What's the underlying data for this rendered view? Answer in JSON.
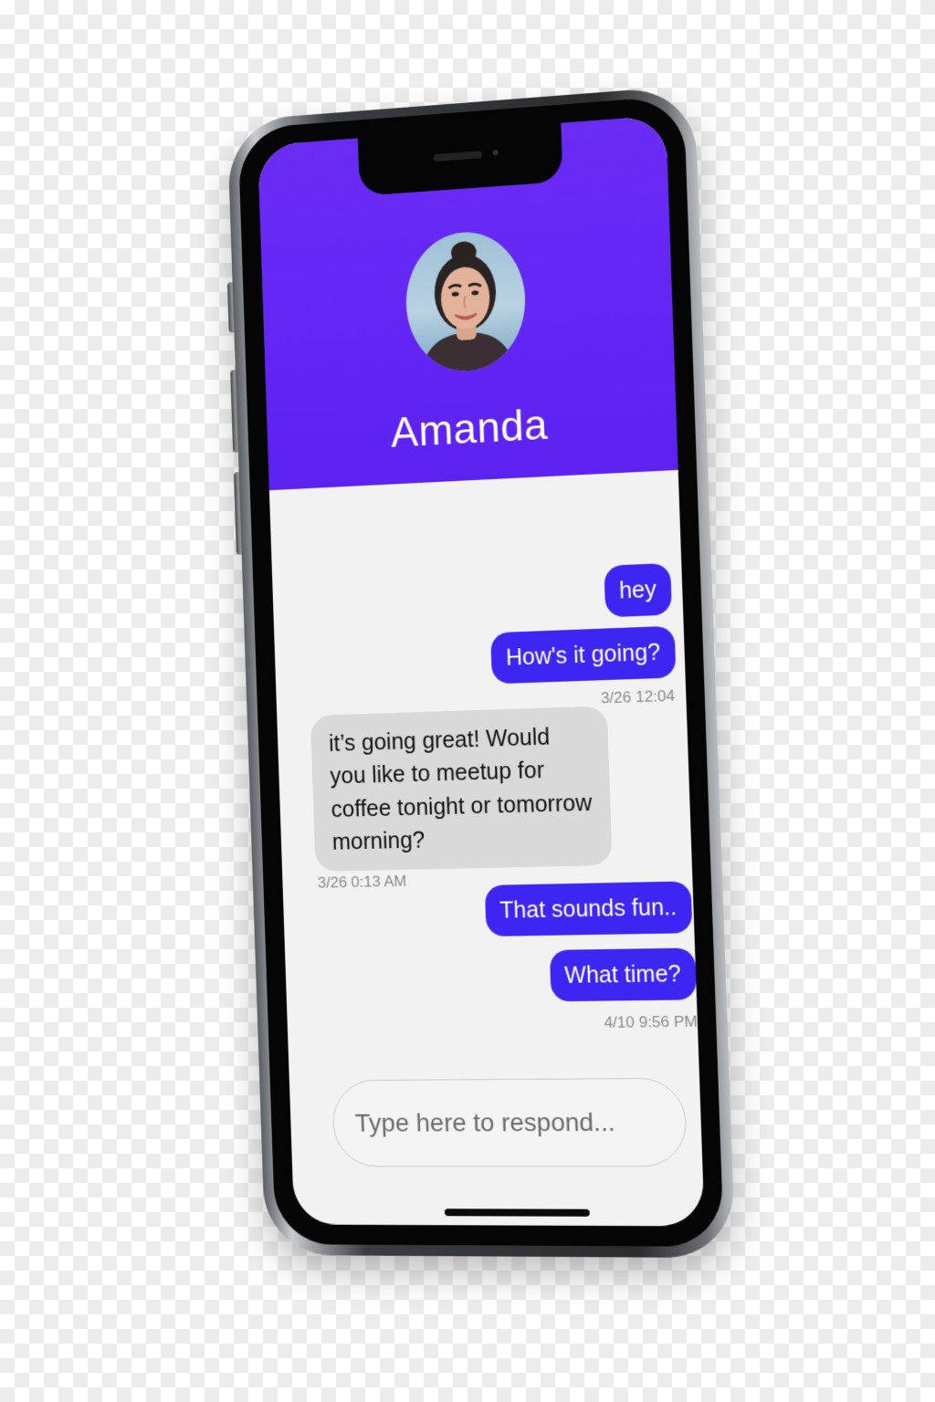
{
  "contact": {
    "name": "Amanda"
  },
  "messages": [
    {
      "direction": "outgoing",
      "text": "hey"
    },
    {
      "direction": "outgoing",
      "text": "How's it going?",
      "timestamp": "3/26 12:04"
    },
    {
      "direction": "incoming",
      "text": "it’s going great! Would you like to meetup for coffee tonight or tomorrow morning?",
      "timestamp": "3/26 0:13 AM"
    },
    {
      "direction": "outgoing",
      "text": "That sounds fun.."
    },
    {
      "direction": "outgoing",
      "text": "What time?",
      "timestamp": "4/10 9:56 PM"
    }
  ],
  "composer": {
    "placeholder": "Type here to respond..."
  },
  "colors": {
    "header": "#6325f5",
    "outgoing_bubble": "#3d25f2",
    "incoming_bubble": "#d9d9d9",
    "screen_background": "#f2f2f2"
  }
}
